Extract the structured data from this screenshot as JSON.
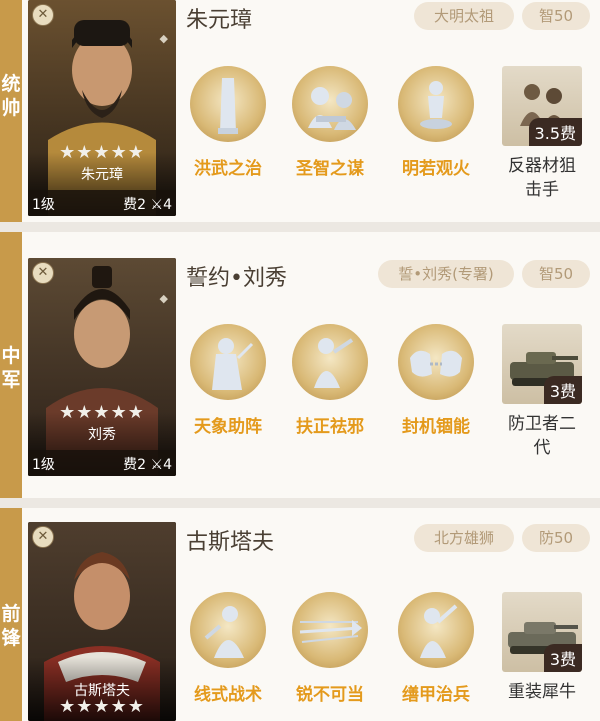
{
  "heroes": [
    {
      "role": "统帅",
      "name": "朱元璋",
      "card_name": "朱元璋",
      "stars": "★★★★★",
      "level": "1级",
      "cost": "费2 ⚔4",
      "tag1": "大明太祖",
      "tag2": "智50",
      "skills": [
        "洪武之治",
        "圣智之谋",
        "明若观火"
      ],
      "unit": {
        "price": "3.5费",
        "name": "反器材狙击手"
      }
    },
    {
      "role": "中军",
      "name": "誓约•刘秀",
      "card_name": "刘秀",
      "stars": "★★★★★",
      "level": "1级",
      "cost": "费2 ⚔4",
      "tag1": "誓•刘秀(专署)",
      "tag2": "智50",
      "skills": [
        "天象助阵",
        "扶正祛邪",
        "封机锢能"
      ],
      "unit": {
        "price": "3费",
        "name": "防卫者二代"
      }
    },
    {
      "role": "前锋",
      "name": "古斯塔夫",
      "card_name": "古斯塔夫",
      "stars": "★★★★★",
      "tag1": "北方雄狮",
      "tag2": "防50",
      "skills": [
        "线式战术",
        "锐不可当",
        "缮甲治兵"
      ],
      "unit": {
        "price": "3费",
        "name": "重装犀牛"
      }
    }
  ],
  "colors": {
    "role_tab": "#c89a4a",
    "skill_label": "#e49a1c",
    "tag_bg": "#efe5d6"
  },
  "icons": [
    "close-badge-icon",
    "sword-icon",
    "shield-icon"
  ]
}
